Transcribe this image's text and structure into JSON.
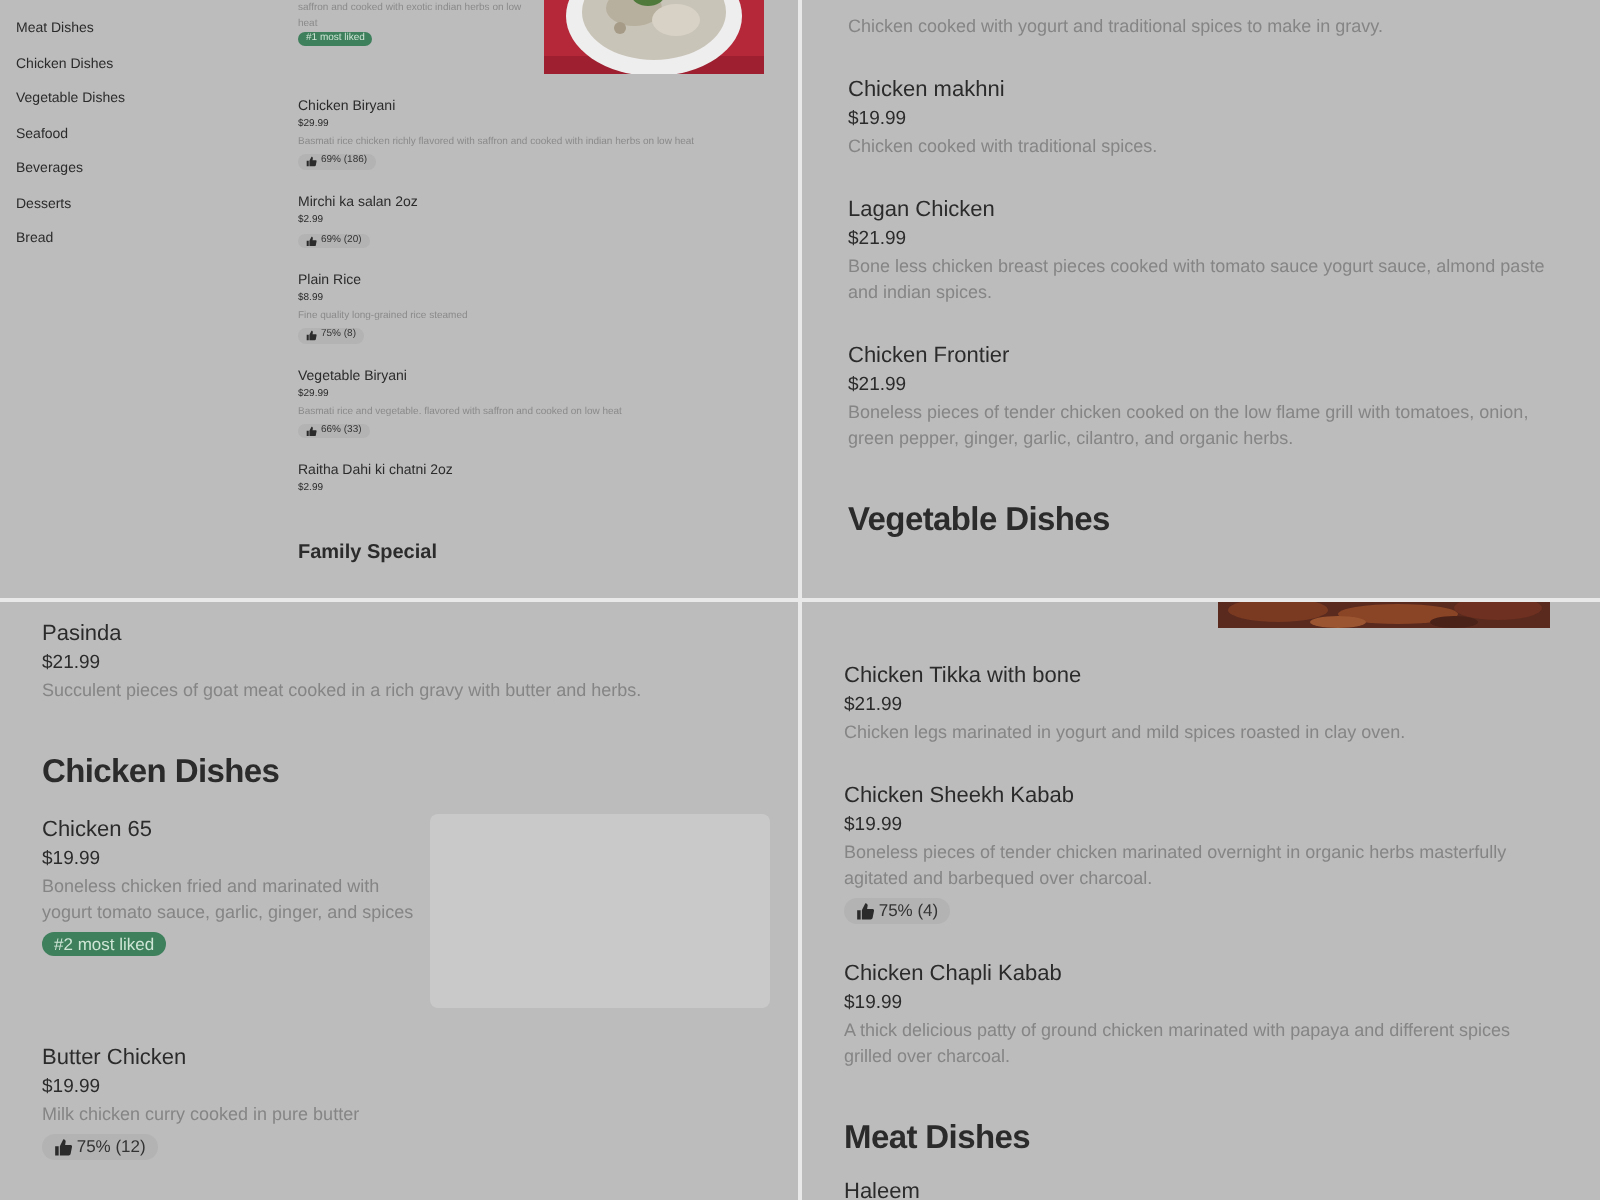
{
  "panels": [
    {
      "kind": "compact",
      "sidebar": [
        "Meat Dishes",
        "Chicken Dishes",
        "Vegetable Dishes",
        "Seafood",
        "Beverages",
        "Desserts",
        "Bread"
      ],
      "entries": [
        {
          "kind": "item_with_photo",
          "description": "saffron and cooked with exotic indian herbs on low heat",
          "badge": "#1 most liked"
        },
        {
          "kind": "item",
          "name": "Chicken Biryani",
          "price": "$29.99",
          "description": "Basmati rice chicken richly flavored with saffron and cooked with indian herbs on low heat",
          "rating": "69% (186)"
        },
        {
          "kind": "item",
          "name": "Mirchi ka salan 2oz",
          "price": "$2.99",
          "rating": "69% (20)"
        },
        {
          "kind": "item",
          "name": "Plain Rice",
          "price": "$8.99",
          "description": "Fine quality long-grained rice steamed",
          "rating": "75% (8)"
        },
        {
          "kind": "item",
          "name": "Vegetable Biryani",
          "price": "$29.99",
          "description": "Basmati rice and vegetable. flavored with saffron and cooked on low heat",
          "rating": "66% (33)"
        },
        {
          "kind": "item",
          "name": "Raitha Dahi ki chatni 2oz",
          "price": "$2.99"
        },
        {
          "kind": "heading",
          "text": "Family Special"
        }
      ]
    },
    {
      "kind": "full",
      "entries": [
        {
          "kind": "item",
          "description": "Chicken cooked with yogurt and traditional spices to make in gravy."
        },
        {
          "kind": "item",
          "name": "Chicken makhni",
          "price": "$19.99",
          "description": "Chicken cooked with traditional spices."
        },
        {
          "kind": "item",
          "name": "Lagan Chicken",
          "price": "$21.99",
          "description": "Bone less chicken breast pieces cooked with tomato sauce yogurt sauce, almond paste and indian spices."
        },
        {
          "kind": "item",
          "name": "Chicken Frontier",
          "price": "$21.99",
          "description": "Boneless pieces of tender chicken cooked on the low flame grill with tomatoes, onion, green pepper, ginger, garlic, cilantro, and organic herbs."
        },
        {
          "kind": "heading",
          "text": "Vegetable Dishes"
        }
      ]
    },
    {
      "kind": "full",
      "entries": [
        {
          "kind": "item",
          "name": "Pasinda",
          "price": "$21.99",
          "description": "Succulent pieces of goat meat cooked in a rich gravy with butter and herbs."
        },
        {
          "kind": "heading",
          "text": "Chicken Dishes"
        },
        {
          "kind": "item_with_placeholder",
          "name": "Chicken 65",
          "price": "$19.99",
          "description": "Boneless chicken fried and marinated with yogurt tomato sauce, garlic, ginger, and spices",
          "badge": "#2 most liked"
        },
        {
          "kind": "item",
          "name": "Butter Chicken",
          "price": "$19.99",
          "description": "Milk chicken curry cooked in pure butter",
          "rating": "75% (12)"
        }
      ]
    },
    {
      "kind": "full",
      "entries": [
        {
          "kind": "photo_strip"
        },
        {
          "kind": "item",
          "name": "Chicken Tikka with bone",
          "price": "$21.99",
          "description": "Chicken legs marinated in yogurt and mild spices roasted in clay oven."
        },
        {
          "kind": "item",
          "name": "Chicken Sheekh Kabab",
          "price": "$19.99",
          "description": "Boneless pieces of tender chicken marinated overnight in organic herbs masterfully agitated and barbequed over charcoal.",
          "rating": "75% (4)"
        },
        {
          "kind": "item",
          "name": "Chicken Chapli Kabab",
          "price": "$19.99",
          "description": "A thick delicious patty of ground chicken marinated with papaya and different spices grilled over charcoal."
        },
        {
          "kind": "heading",
          "text": "Meat Dishes"
        },
        {
          "kind": "item",
          "name": "Haleem"
        }
      ]
    }
  ]
}
